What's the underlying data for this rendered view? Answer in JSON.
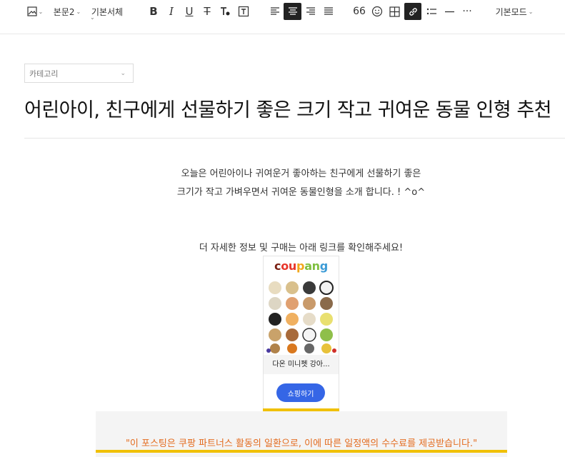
{
  "toolbar": {
    "paragraph_style": "본문2",
    "font_face": "기본서체",
    "mode": "기본모드"
  },
  "category": {
    "placeholder": "카테고리"
  },
  "post": {
    "title": "어린아이, 친구에게 선물하기 좋은 크기 작고 귀여운 동물 인형 추천",
    "intro_line1": "오늘은 어린아이나 귀여운거 좋아하는 친구에게 선물하기 좋은",
    "intro_line2": "크기가 작고 가벼우면서 귀여운 동물인형을 소개 합니다. ! ^o^",
    "link_prompt": "더 자세한 정보 및 구매는 아래 링크를 확인해주세요!"
  },
  "product_card": {
    "logo": {
      "c1": "c",
      "c2": "ou",
      "c3": "p",
      "c4": "an",
      "c5": "g"
    },
    "name": "다온 미니펫 강아...",
    "button_label": "쇼핑하기"
  },
  "disclaimer": "\"이 포스팅은 쿠팡 파트너스 활동의 일환으로, 이에 따른 일정액의 수수료를 제공받습니다.\"",
  "colors": {
    "accent": "#3566e6",
    "highlight": "#f0c000",
    "disclaimer_text": "#e36b1e"
  }
}
